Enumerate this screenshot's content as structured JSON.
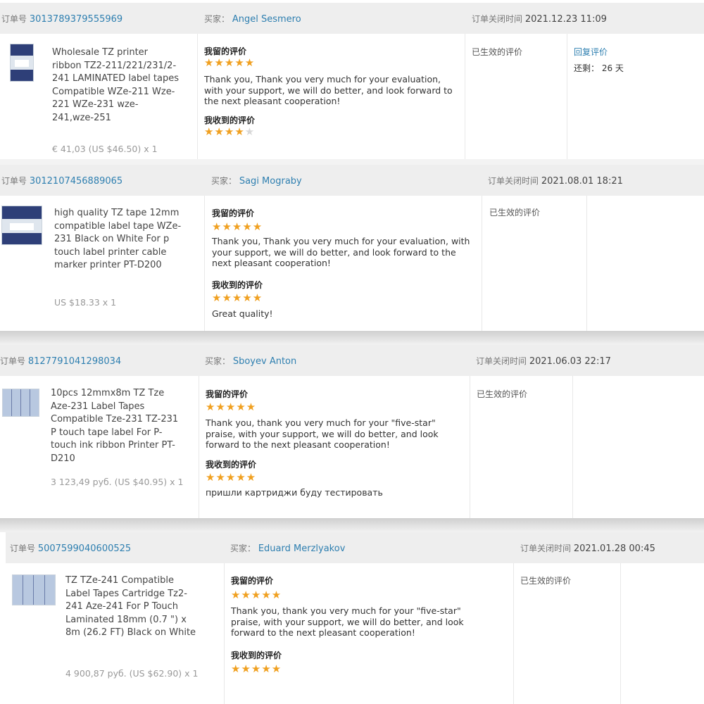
{
  "common": {
    "order_label": "订单号",
    "buyer_label": "买家：",
    "closed_label": "订单关闭时间",
    "my_review_label": "我留的评价",
    "received_review_label": "我收到的评价",
    "status_text": "已生效的评价"
  },
  "orders": [
    {
      "order_no": "3013789379555969",
      "buyer": "Angel Sesmero",
      "closed_time": "2021.12.23 11:09",
      "product_name": "Wholesale TZ printer ribbon TZ2-211/221/231/2-241 LAMINATED label tapes Compatible WZe-211 Wze-221 WZe-231 wze-241,wze-251",
      "price": "€ 41,03 (US $46.50) x 1",
      "my_rating": 5,
      "my_reply": "Thank you, Thank you very much for your evaluation, with your support, we will do better, and look forward to the next pleasant cooperation!",
      "received_rating": 4,
      "received_comment": "",
      "reply_link": "回复评价",
      "remaining": "还剩： 26 天"
    },
    {
      "order_no": "3012107456889065",
      "buyer": "Sagi Mograby",
      "closed_time": "2021.08.01 18:21",
      "product_name": "high quality TZ tape 12mm compatible label tape WZe-231 Black on White For p touch label printer cable marker printer PT-D200",
      "price": "US $18.33 x 1",
      "my_rating": 5,
      "my_reply": "Thank you, Thank you very much for your evaluation, with your support, we will do better, and look forward to the next pleasant cooperation!",
      "received_rating": 5,
      "received_comment": "Great quality!"
    },
    {
      "order_no": "8127791041298034",
      "buyer": "Sboyev Anton",
      "closed_time": "2021.06.03 22:17",
      "product_name": "10pcs 12mmx8m TZ Tze Aze-231 Label Tapes Compatible Tze-231 TZ-231 P touch tape label For P-touch ink ribbon Printer PT-D210",
      "price": "3 123,49 руб. (US $40.95) x 1",
      "my_rating": 5,
      "my_reply": "Thank you, thank you very much for your \"five-star\" praise, with your support, we will do better, and look forward to the next pleasant cooperation!",
      "received_rating": 5,
      "received_comment": "пришли картриджи буду тестировать"
    },
    {
      "order_no": "5007599040600525",
      "buyer": "Eduard Merzlyakov",
      "closed_time": "2021.01.28 00:45",
      "product_name": "TZ TZe-241 Compatible Label Tapes Cartridge Tz2-241 Aze-241 For P Touch Laminated 18mm (0.7 \") x 8m (26.2 FT) Black on White",
      "price": "4 900,87 руб. (US $62.90) x 1",
      "my_rating": 5,
      "my_reply": "Thank you, thank you very much for your \"five-star\" praise, with your support, we will do better, and look forward to the next pleasant cooperation!",
      "received_rating": 5,
      "received_comment": ""
    }
  ],
  "colors": {
    "link": "#2e7fb0",
    "star": "#f0a020",
    "header_bg": "#eeeeee"
  }
}
